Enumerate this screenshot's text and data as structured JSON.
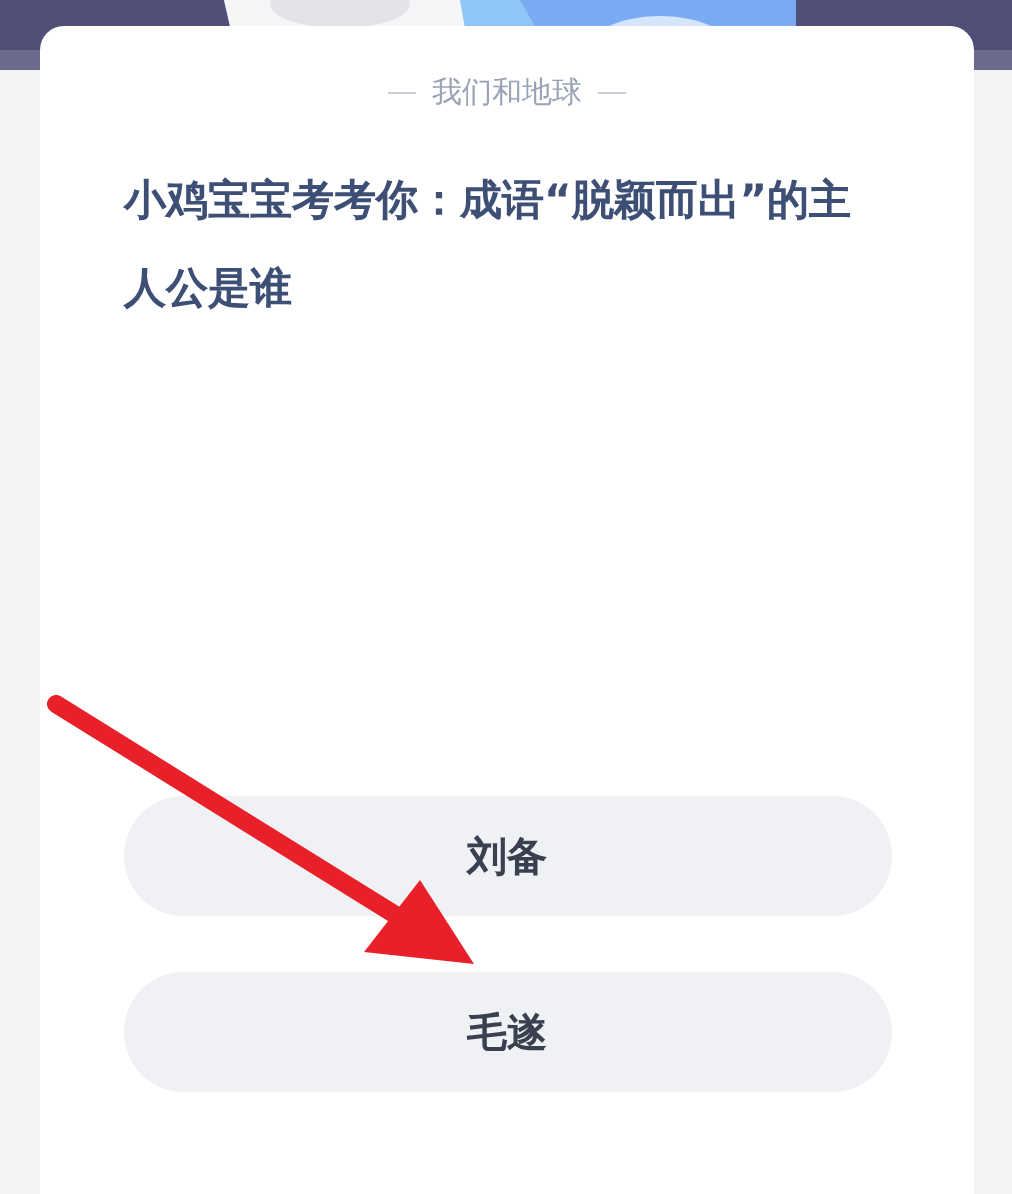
{
  "quiz": {
    "category": "我们和地球",
    "question": "小鸡宝宝考考你：成语“脱颖而出”的主人公是谁",
    "options": [
      {
        "label": "刘备"
      },
      {
        "label": "毛遂"
      }
    ]
  }
}
